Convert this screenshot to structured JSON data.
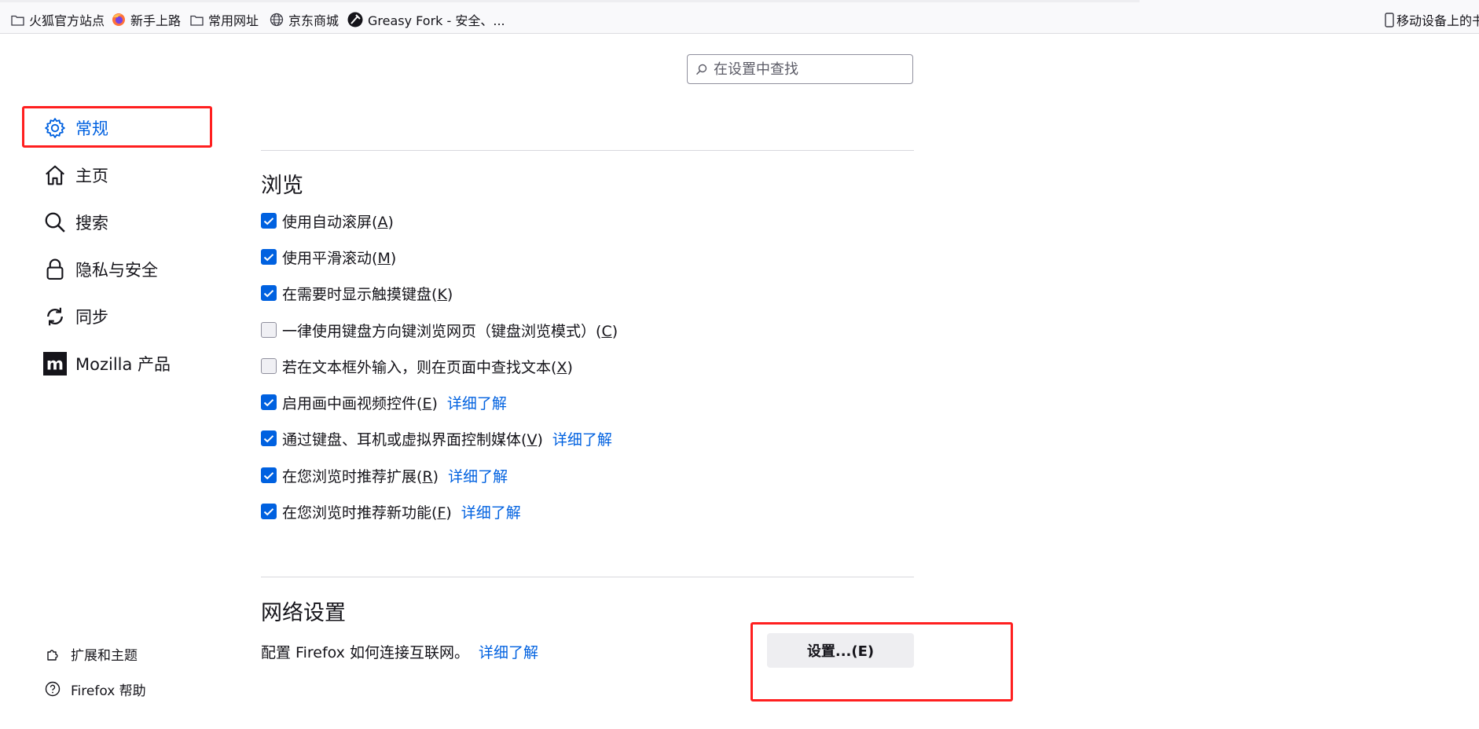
{
  "bookmarks": {
    "items": [
      {
        "label": "火狐官方站点",
        "icon": "folder-icon"
      },
      {
        "label": "新手上路",
        "icon": "firefox-icon"
      },
      {
        "label": "常用网址",
        "icon": "folder-icon"
      },
      {
        "label": "京东商城",
        "icon": "globe-icon"
      },
      {
        "label": "Greasy Fork - 安全、...",
        "icon": "greasyfork-icon"
      }
    ],
    "mobile_label": "移动设备上的书签"
  },
  "search": {
    "placeholder": "在设置中查找"
  },
  "sidebar": {
    "items": [
      {
        "label": "常规",
        "icon": "gear-icon",
        "active": true
      },
      {
        "label": "主页",
        "icon": "home-icon"
      },
      {
        "label": "搜索",
        "icon": "search-icon"
      },
      {
        "label": "隐私与安全",
        "icon": "lock-icon"
      },
      {
        "label": "同步",
        "icon": "sync-icon"
      },
      {
        "label": "Mozilla 产品",
        "icon": "mozilla-icon"
      }
    ],
    "footer": [
      {
        "label": "扩展和主题",
        "icon": "puzzle-icon"
      },
      {
        "label": "Firefox 帮助",
        "icon": "help-icon"
      }
    ]
  },
  "browsing": {
    "title": "浏览",
    "options": [
      {
        "text": "使用自动滚屏",
        "key": "A",
        "checked": true,
        "link": ""
      },
      {
        "text": "使用平滑滚动",
        "key": "M",
        "checked": true,
        "link": ""
      },
      {
        "text": "在需要时显示触摸键盘",
        "key": "K",
        "checked": true,
        "link": ""
      },
      {
        "text": "一律使用键盘方向键浏览网页（键盘浏览模式）",
        "key": "C",
        "checked": false,
        "link": ""
      },
      {
        "text": "若在文本框外输入，则在页面中查找文本",
        "key": "X",
        "checked": false,
        "link": ""
      },
      {
        "text": "启用画中画视频控件",
        "key": "E",
        "checked": true,
        "link": "详细了解"
      },
      {
        "text": "通过键盘、耳机或虚拟界面控制媒体",
        "key": "V",
        "checked": true,
        "link": "详细了解"
      },
      {
        "text": "在您浏览时推荐扩展",
        "key": "R",
        "checked": true,
        "link": "详细了解"
      },
      {
        "text": "在您浏览时推荐新功能",
        "key": "F",
        "checked": true,
        "link": "详细了解"
      }
    ]
  },
  "network": {
    "title": "网络设置",
    "description": "配置 Firefox 如何连接互联网。",
    "link": "详细了解",
    "button_label": "设置...(E)"
  },
  "colors": {
    "accent": "#0061e0",
    "highlight": "#ff1f1f"
  }
}
